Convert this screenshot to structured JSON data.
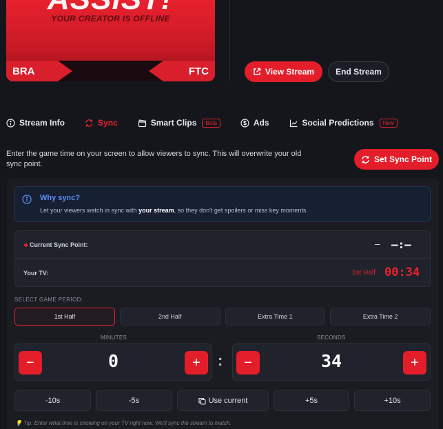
{
  "banner": {
    "headline": "ASSIST!",
    "subtitle": "YOUR CREATOR IS OFFLINE",
    "team_left": "BRA",
    "team_right": "FTC"
  },
  "actions": {
    "view_stream": "View Stream",
    "end_stream": "End Stream"
  },
  "tabs": [
    {
      "label": "Stream Info",
      "icon": "info-icon"
    },
    {
      "label": "Sync",
      "icon": "sync-icon",
      "active": true
    },
    {
      "label": "Smart Clips",
      "icon": "clapperboard-icon",
      "badge": "Beta"
    },
    {
      "label": "Ads",
      "icon": "dollar-icon"
    },
    {
      "label": "Social Predictions",
      "icon": "chart-icon",
      "badge": "New"
    }
  ],
  "sync": {
    "description": "Enter the game time on your screen to allow viewers to sync. This will overwrite your old sync point.",
    "set_button": "Set Sync Point",
    "info_title": "Why sync?",
    "info_pre": "Let your viewers watch in sync with ",
    "info_bold": "your stream",
    "info_post": ", so they don't get spoilers or miss key moments.",
    "current_label": "Current Sync Point:",
    "current_dash": "–",
    "current_value": "–:—",
    "tv_label": "Your TV:",
    "tv_half": "1st Half",
    "tv_time": "00:34",
    "period_label": "SELECT GAME PERIOD:",
    "periods": [
      "1st Half",
      "2nd Half",
      "Extra Time 1",
      "Extra Time 2"
    ],
    "minutes_label": "MINUTES",
    "seconds_label": "SECONDS",
    "minutes": "0",
    "seconds": "34",
    "minus": "−",
    "plus": "+",
    "colon": ":",
    "quick": [
      "-10s",
      "-5s",
      "Use current",
      "+5s",
      "+10s"
    ],
    "tip": "Tip: Enter what time is showing on your TV right now. We'll sync the stream to match."
  },
  "colors": {
    "accent": "#e31e2a",
    "info": "#5a8cf5",
    "bg": "#14161c"
  }
}
